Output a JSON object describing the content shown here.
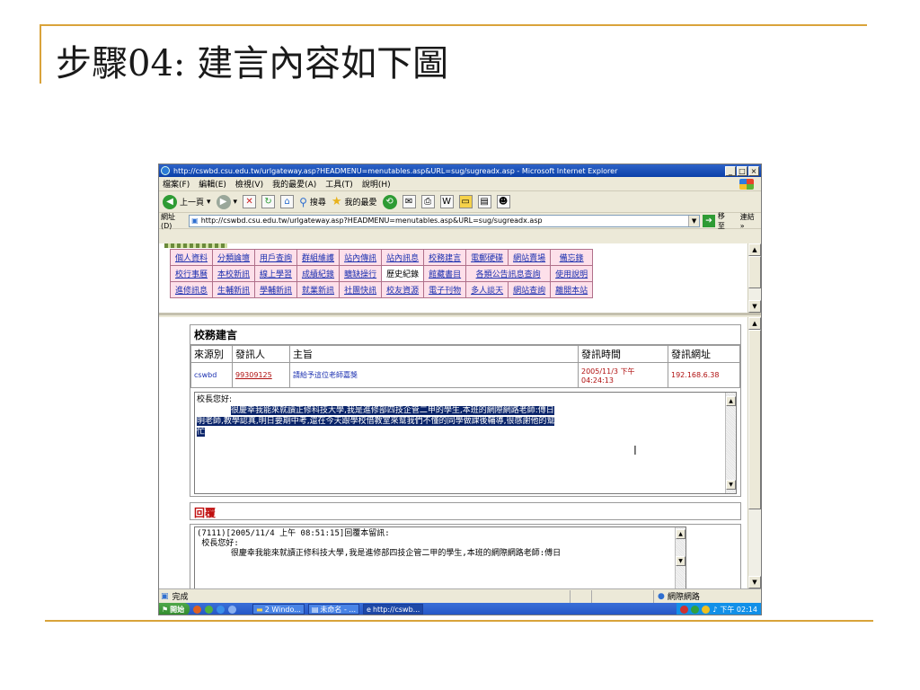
{
  "slide": {
    "title": "步驟04: 建言內容如下圖"
  },
  "browser": {
    "window_title": "http://cswbd.csu.edu.tw/urlgateway.asp?HEADMENU=menutables.asp&URL=sug/sugreadx.asp - Microsoft Internet Explorer",
    "menu": [
      "檔案(F)",
      "編輯(E)",
      "檢視(V)",
      "我的最愛(A)",
      "工具(T)",
      "說明(H)"
    ],
    "toolbar": {
      "back": "上一頁",
      "search": "搜尋",
      "favorites": "我的最愛"
    },
    "address": {
      "label": "網址(D)",
      "url": "http://cswbd.csu.edu.tw/urlgateway.asp?HEADMENU=menutables.asp&URL=sug/sugreadx.asp",
      "go": "移至",
      "links": "連結 »"
    },
    "status": {
      "text": "完成",
      "zone": "網際網路"
    }
  },
  "nav_menu": [
    [
      "個人資料",
      "分類論壇",
      "用戶查詢",
      "群組維護",
      "站內傳訊",
      "站內訊息",
      "校務建言",
      "電郵硬碟",
      "網站賣場",
      "備忘錄"
    ],
    [
      "校行事曆",
      "本校新訊",
      "線上學習",
      "成績紀錄",
      "曠缺操行",
      "歷史紀錄",
      "館藏書目",
      "各類公告訊息查詢",
      "使用說明"
    ],
    [
      "進修訊息",
      "生輔新訊",
      "學輔新訊",
      "就業新訊",
      "社團快訊",
      "校友資源",
      "電子刊物",
      "多人談天",
      "網站查詢",
      "離開本站"
    ]
  ],
  "suggestion": {
    "section_title": "校務建言",
    "headers": {
      "source": "來源別",
      "sender": "發訊人",
      "subject": "主旨",
      "time": "發訊時間",
      "ip": "發訊網址"
    },
    "row": {
      "source": "cswbd",
      "sender": "99309125",
      "subject": "請給予這位老師嘉獎",
      "time": "2005/11/3 下午 04:24:13",
      "ip": "192.168.6.38"
    },
    "body_greeting": "校長您好:",
    "body_line1": "很慶幸我能來就讀正修科技大學,我是進修部四技企管二甲的學生,本班的網際網路老師:傅日",
    "body_line2": "明老師,教學認真,明日要期中考,還在今天跟學校借教室來幫我們不懂的同學做課後輔導,很感謝他的幫",
    "body_line3": "忙"
  },
  "reply": {
    "section_title": "回覆",
    "line1": "(7111)[2005/11/4 上午 08:51:15]回覆本留訊:",
    "line2": " 校長您好:",
    "line3": "       很慶幸我能來就讀正修科技大學,我是進修部四技企管二甲的學生,本班的網際網路老師:傅日"
  },
  "taskbar": {
    "start": "開始",
    "tasks": [
      "2 Windo...",
      "未命名 - ...",
      "http://cswb..."
    ],
    "clock": "下午 02:14"
  }
}
